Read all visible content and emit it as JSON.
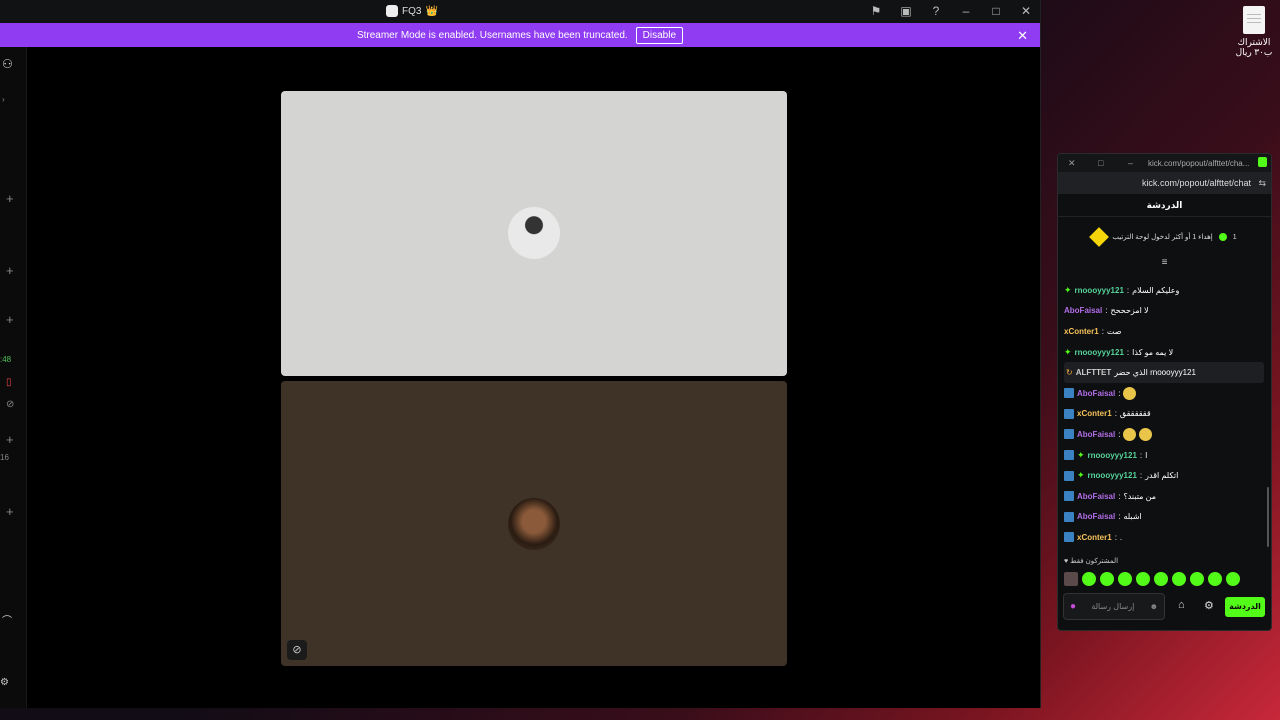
{
  "desktop": {
    "icon_label": "الاشتراك ب٣٠ ريال"
  },
  "window": {
    "title": "FQ3",
    "title_emoji": "👑",
    "icons": [
      "flag-icon",
      "inbox-icon",
      "help-icon",
      "minimize-icon",
      "maximize-icon",
      "close-icon"
    ]
  },
  "banner": {
    "text": "Streamer Mode is enabled. Usernames have been truncated.",
    "button": "Disable",
    "color": "#8f3cf2"
  },
  "sidebar": {
    "time_partial": ":48",
    "count_partial": "16"
  },
  "chat": {
    "tab_title": "kick.com/popout/alfttet/cha...",
    "url": "kick.com/popout/alfttet/chat",
    "channel": "الدردشة",
    "goal_text": "إهداء 1 أو أكثر لدخول لوحة الترتيب",
    "goal_amount": "1",
    "messages": [
      {
        "badge": "green",
        "user": "rnoooyyy121",
        "user_color": "green",
        "text": "وعليكم السلام"
      },
      {
        "badge": "none",
        "user": "AboFaisal",
        "user_color": "purple",
        "text": "لا امزحححح"
      },
      {
        "badge": "none",
        "user": "xConter1",
        "user_color": "yellow",
        "text": "صت"
      },
      {
        "badge": "green",
        "user": "rnoooyyy121",
        "user_color": "green",
        "text": "لا يمه مو كذا"
      },
      {
        "badge": "host",
        "user": "ALFTTET",
        "user_color": "white",
        "text": "الذي حضر rnoooyyy121",
        "highlight": true
      },
      {
        "badge": "blue",
        "user": "AboFaisal",
        "user_color": "purple",
        "text": "",
        "emotes": 1
      },
      {
        "badge": "blue",
        "user": "xConter1",
        "user_color": "yellow",
        "text": "ققققققق"
      },
      {
        "badge": "blue",
        "user": "AboFaisal",
        "user_color": "purple",
        "text": "",
        "emotes": 2
      },
      {
        "badge": "blue-green",
        "user": "rnoooyyy121",
        "user_color": "green",
        "text": "ا"
      },
      {
        "badge": "blue-green",
        "user": "rnoooyyy121",
        "user_color": "green",
        "text": "اتكلم اقدر"
      },
      {
        "badge": "blue",
        "user": "AboFaisal",
        "user_color": "purple",
        "text": "من متبند؟"
      },
      {
        "badge": "blue",
        "user": "AboFaisal",
        "user_color": "purple",
        "text": "اشبله"
      },
      {
        "badge": "blue",
        "user": "xConter1",
        "user_color": "yellow",
        "text": "."
      }
    ],
    "subscribers_only": "المشتركون فقط",
    "input_placeholder": "إرسال رسالة",
    "send_label": "الدردشة",
    "accent": "#53fc18"
  }
}
